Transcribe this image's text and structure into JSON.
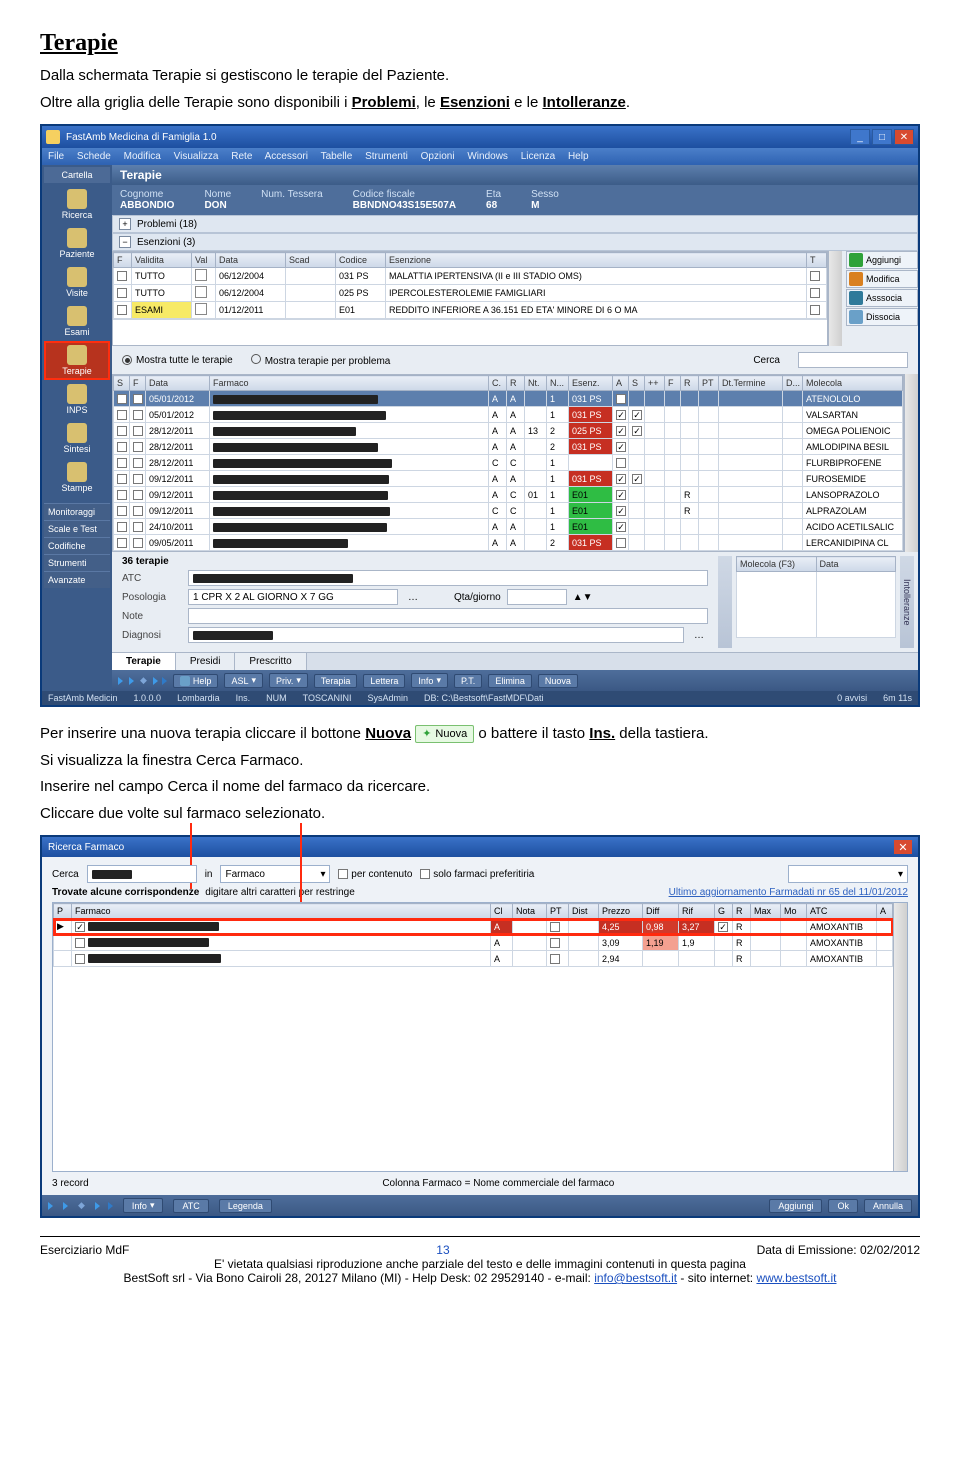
{
  "doc": {
    "title": "Terapie",
    "intro1": "Dalla schermata Terapie si gestiscono le terapie del Paziente.",
    "intro2_a": "Oltre alla griglia delle Terapie sono disponibili i ",
    "intro2_b": "Problemi",
    "intro2_c": ", le ",
    "intro2_d": "Esenzioni",
    "intro2_e": " e le ",
    "intro2_f": "Intolleranze",
    "intro2_g": ".",
    "mid1_a": "Per inserire una nuova terapia cliccare il bottone ",
    "mid1_b": "Nuova",
    "mid1_pill": "Nuova",
    "mid1_c": " o battere il tasto ",
    "mid1_d": "Ins.",
    "mid1_e": " della tastiera.",
    "mid2": "Si visualizza la finestra Cerca Farmaco.",
    "mid3": "Inserire nel campo Cerca il nome del farmaco da ricercare.",
    "mid4": "Cliccare due volte sul farmaco selezionato."
  },
  "app": {
    "window_title": "FastAmb Medicina di Famiglia 1.0",
    "menus": [
      "File",
      "Schede",
      "Modifica",
      "Visualizza",
      "Rete",
      "Accessori",
      "Tabelle",
      "Strumenti",
      "Opzioni",
      "Windows",
      "Licenza",
      "Help"
    ],
    "sidenav_header": "Cartella",
    "sidenav_items": [
      "Ricerca",
      "Paziente",
      "Visite",
      "Esami",
      "Terapie",
      "INPS",
      "Sintesi",
      "Stampe"
    ],
    "sidenav_lower": [
      "Monitoraggi",
      "Scale e Test",
      "Codifiche",
      "Strumenti",
      "Avanzate"
    ],
    "section_title": "Terapie",
    "patient": {
      "cognome_lbl": "Cognome",
      "cognome": "ABBONDIO",
      "nome_lbl": "Nome",
      "nome": "DON",
      "tessera_lbl": "Num. Tessera",
      "tessera": "",
      "cf_lbl": "Codice fiscale",
      "cf": "BBNDNO43S15E507A",
      "eta_lbl": "Eta",
      "eta": "68",
      "sesso_lbl": "Sesso",
      "sesso": "M"
    },
    "collapse1": "Problemi (18)",
    "collapse2": "Esenzioni (3)",
    "esenz_headers": [
      "F",
      "Validita",
      "Val",
      "Data",
      "Scad",
      "Codice",
      "Esenzione",
      "T"
    ],
    "esenz_rows": [
      {
        "f": "",
        "validita": "TUTTO",
        "val": "",
        "data": "06/12/2004",
        "scad": "",
        "codice": "031 PS",
        "esenzione": "MALATTIA IPERTENSIVA (II e III STADIO OMS)",
        "t": ""
      },
      {
        "f": "",
        "validita": "TUTTO",
        "val": "",
        "data": "06/12/2004",
        "scad": "",
        "codice": "025 PS",
        "esenzione": "IPERCOLESTEROLEMIE FAMIGLIARI",
        "t": ""
      },
      {
        "f": "",
        "validita": "ESAMI",
        "val": "",
        "data": "01/12/2011",
        "scad": "",
        "codice": "E01",
        "esenzione": "REDDITO INFERIORE A 36.151 ED ETA' MINORE DI 6 O MA",
        "t": "",
        "yellow": true
      }
    ],
    "side_actions": [
      "Aggiungi",
      "Modifica",
      "Asssocia",
      "Dissocia"
    ],
    "radio1": "Mostra tutte le terapie",
    "radio2": "Mostra terapie per problema",
    "cerca_lbl": "Cerca",
    "terapie_headers": [
      "S",
      "F",
      "Data",
      "Farmaco",
      "C.",
      "R",
      "Nt.",
      "N...",
      "Esenz.",
      "A",
      "S",
      "++",
      "F",
      "R",
      "PT",
      "Dt.Termine",
      "D...",
      "Molecola"
    ],
    "terapie_rows": [
      {
        "data": "05/01/2012",
        "c": "A",
        "r": "A",
        "n": "1",
        "esenz": "031 PS",
        "a": true,
        "sel": true,
        "mol": "ATENOLOLO",
        "esenzcolor": "red"
      },
      {
        "data": "05/01/2012",
        "c": "A",
        "r": "A",
        "n": "1",
        "esenz": "031 PS",
        "a": true,
        "s": true,
        "mol": "VALSARTAN",
        "esenzcolor": "red"
      },
      {
        "data": "28/12/2011",
        "c": "A",
        "r": "A",
        "nt": "13",
        "n": "2",
        "esenz": "025 PS",
        "a": true,
        "s": true,
        "mol": "OMEGA POLIENOIC",
        "esenzcolor": "red"
      },
      {
        "data": "28/12/2011",
        "c": "A",
        "r": "A",
        "n": "2",
        "esenz": "031 PS",
        "a": true,
        "mol": "AMLODIPINA BESIL",
        "esenzcolor": "red"
      },
      {
        "data": "28/12/2011",
        "c": "C",
        "r": "C",
        "n": "1",
        "esenz": "",
        "mol": "FLURBIPROFENE"
      },
      {
        "data": "09/12/2011",
        "c": "A",
        "r": "A",
        "n": "1",
        "esenz": "031 PS",
        "a": true,
        "s": true,
        "mol": "FUROSEMIDE",
        "esenzcolor": "red"
      },
      {
        "data": "09/12/2011",
        "c": "A",
        "r": "C",
        "nt": "01",
        "n": "1",
        "esenz": "E01",
        "a": true,
        "rflag": "R",
        "mol": "LANSOPRAZOLO",
        "esenzcolor": "green"
      },
      {
        "data": "09/12/2011",
        "c": "C",
        "r": "C",
        "n": "1",
        "esenz": "E01",
        "a": true,
        "rflag": "R",
        "mol": "ALPRAZOLAM",
        "esenzcolor": "green"
      },
      {
        "data": "24/10/2011",
        "c": "A",
        "r": "A",
        "n": "1",
        "esenz": "E01",
        "a": true,
        "mol": "ACIDO ACETILSALIC",
        "esenzcolor": "green"
      },
      {
        "data": "09/05/2011",
        "c": "A",
        "r": "A",
        "n": "2",
        "esenz": "031 PS",
        "mol": "LERCANIDIPINA CL",
        "esenzcolor": "red"
      }
    ],
    "count_label": "36 terapie",
    "bottom_lbls": {
      "atc": "ATC",
      "molecola": "Molecola (F3)",
      "data": "Data",
      "posologia": "Posologia",
      "qta": "Qta/giorno",
      "note": "Note",
      "diagnosi": "Diagnosi"
    },
    "posologia_value": "1 CPR X 2 AL GIORNO X 7 GG",
    "bottom_tabs": [
      "Terapie",
      "Presidi",
      "Prescritto"
    ],
    "side_panel_label": "Intolleranze",
    "toolbar": {
      "help": "Help",
      "asl": "ASL",
      "priv": "Priv.",
      "terapia": "Terapia",
      "lettera": "Lettera",
      "info": "Info",
      "pt": "P.T.",
      "elimina": "Elimina",
      "nuova": "Nuova"
    },
    "status": [
      "FastAmb Medicin",
      "1.0.0.0",
      "Lombardia",
      "Ins.",
      "NUM",
      "TOSCANINI",
      "SysAdmin",
      "DB: C:\\Bestsoft\\FastMDF\\Dati",
      "0 avvisi",
      "6m 11s"
    ]
  },
  "dialog": {
    "title": "Ricerca Farmaco",
    "cerca_lbl": "Cerca",
    "in_lbl": "in",
    "combo_val": "Farmaco",
    "chk1": "per contenuto",
    "chk2": "solo farmaci preferitiria",
    "found_a": "Trovate alcune corrispondenze",
    "found_b": "digitare altri caratteri per restringe",
    "update_link": "Ultimo aggiornamento Farmadati nr 65 del 11/01/2012",
    "headers": [
      "P",
      "Farmaco",
      "Cl",
      "Nota",
      "PT",
      "Dist",
      "Prezzo",
      "Diff",
      "Rif",
      "G",
      "R",
      "Max",
      "Mo",
      "ATC",
      "A"
    ],
    "rows": [
      {
        "p": true,
        "chk": true,
        "cl": "A",
        "prezzo": "4,25",
        "diff": "0,98",
        "rif": "3,27",
        "g": true,
        "r": "R",
        "atc": "AMOXANTIB",
        "hl": true,
        "diffred": true
      },
      {
        "cl": "A",
        "prezzo": "3,09",
        "diff": "1,19",
        "rif": "1,9",
        "r": "R",
        "atc": "AMOXANTIB",
        "diffsoft": true
      },
      {
        "cl": "A",
        "prezzo": "2,94",
        "rif": "",
        "r": "R",
        "atc": "AMOXANTIB"
      }
    ],
    "rec_count": "3 record",
    "footer_note": "Colonna Farmaco = Nome commerciale del farmaco",
    "buttons": {
      "info": "Info",
      "atc": "ATC",
      "legenda": "Legenda",
      "aggiungi": "Aggiungi",
      "ok": "Ok",
      "annulla": "Annulla"
    }
  },
  "footer": {
    "left": "Eserciziario MdF",
    "page": "13",
    "right": "Data di Emissione: 02/02/2012",
    "line2": "E' vietata qualsiasi riproduzione anche parziale del testo e delle immagini contenuti in questa pagina",
    "line3_a": "BestSoft srl - Via Bono Cairoli 28, 20127 Milano (MI) - Help Desk: 02 29529140 - e-mail: ",
    "line3_email": "info@bestsoft.it",
    "line3_b": " - sito internet: ",
    "line3_site": "www.bestsoft.it"
  }
}
